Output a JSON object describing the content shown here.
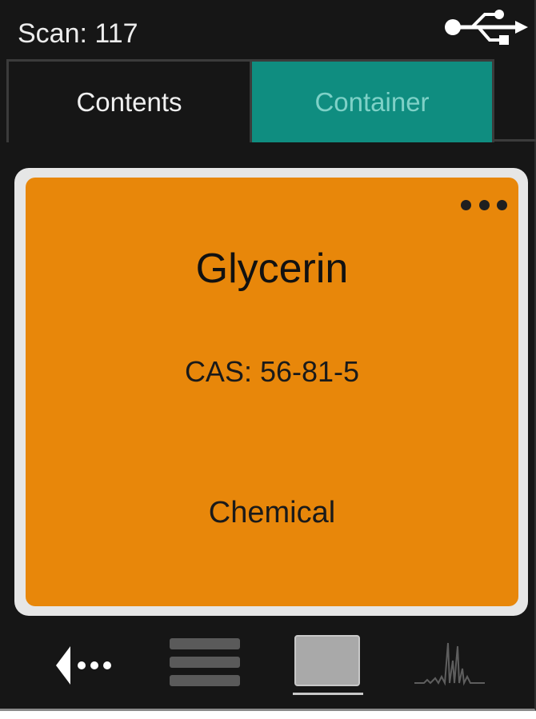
{
  "status_bar": {
    "scan_text": "Scan: 117",
    "usb_icon": "usb-icon"
  },
  "tabs": [
    {
      "label": "Contents",
      "active": true
    },
    {
      "label": "Container",
      "active": false
    }
  ],
  "card": {
    "name": "Glycerin",
    "cas": "CAS: 56-81-5",
    "category": "Chemical",
    "menu_icon": "more-dots-icon",
    "color": "#e8870a"
  },
  "bottom_nav": {
    "icons": [
      "back-arrow-icon",
      "list-icon",
      "card-view-icon",
      "spectrum-icon"
    ],
    "selected": "card-view-icon"
  },
  "colors": {
    "background": "#161616",
    "tab_active_bg": "#0f8d80",
    "tab_inactive_text": "#7ed1c7",
    "card_border": "#e6e6e6"
  }
}
